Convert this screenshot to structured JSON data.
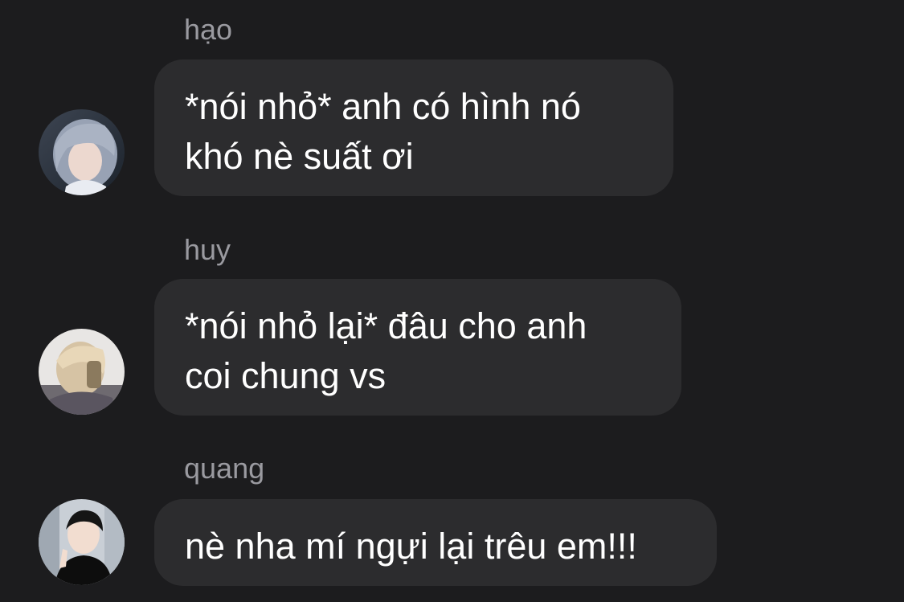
{
  "messages": [
    {
      "sender": "hạo",
      "text": "*nói nhỏ* anh có hình nó\nkhó nè suất ơi",
      "avatar_icon": "user-avatar-hao"
    },
    {
      "sender": "huy",
      "text": "*nói nhỏ lại* đâu cho anh\ncoi chung vs",
      "avatar_icon": "user-avatar-huy"
    },
    {
      "sender": "quang",
      "text": "nè nha mí ngựi lại trêu em!!!",
      "avatar_icon": "user-avatar-quang"
    }
  ],
  "colors": {
    "background": "#1c1c1e",
    "bubble": "#2c2c2e",
    "sender_name": "#9a9aa0",
    "message_text": "#ffffff"
  }
}
